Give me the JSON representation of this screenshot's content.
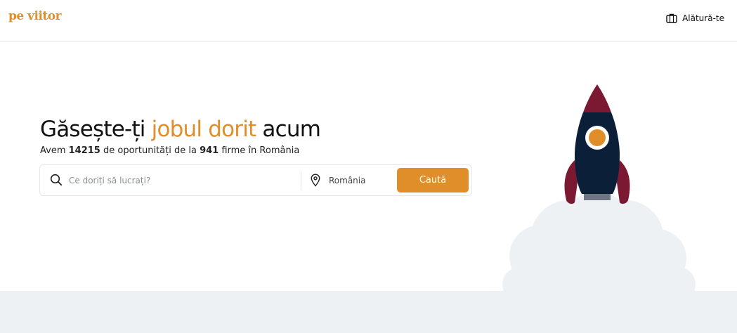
{
  "header": {
    "logo": "pe viitor",
    "join_label": "Alătură-te",
    "join_icon": "briefcase-icon"
  },
  "hero": {
    "title_part1": "Găsește-ți ",
    "title_highlight": "jobul dorit",
    "title_part2": " acum",
    "subtitle_prefix": "Avem ",
    "jobs_count": "14215",
    "subtitle_middle": " de oportunități de la ",
    "companies_count": "941",
    "subtitle_suffix": " firme în România"
  },
  "search": {
    "placeholder": "Ce doriți să lucrați?",
    "search_icon": "search-icon",
    "location_value": "România",
    "location_icon": "map-pin-icon",
    "button_label": "Caută"
  },
  "colors": {
    "accent": "#e08e29",
    "rocket_body": "#0b2038",
    "rocket_fins": "#7b1832",
    "smoke": "#eef1f4",
    "nozzle": "#6e7683"
  },
  "illustration": "rocket"
}
